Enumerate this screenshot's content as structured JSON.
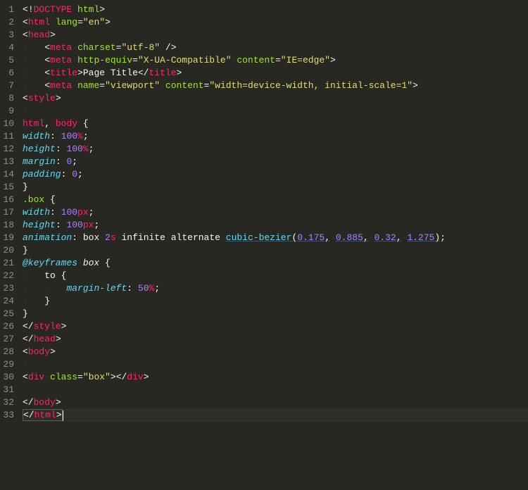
{
  "editor": {
    "line_count": 33,
    "lines": [
      {
        "n": 1,
        "raw": "<!DOCTYPE html>"
      },
      {
        "n": 2,
        "raw": "<html lang=\"en\">"
      },
      {
        "n": 3,
        "raw": "<head>"
      },
      {
        "n": 4,
        "raw": "    <meta charset=\"utf-8\" />"
      },
      {
        "n": 5,
        "raw": "    <meta http-equiv=\"X-UA-Compatible\" content=\"IE=edge\">"
      },
      {
        "n": 6,
        "raw": "    <title>Page Title</title>"
      },
      {
        "n": 7,
        "raw": "    <meta name=\"viewport\" content=\"width=device-width, initial-scale=1\">"
      },
      {
        "n": 8,
        "raw": "<style>"
      },
      {
        "n": 9,
        "raw": ""
      },
      {
        "n": 10,
        "raw": "html, body {"
      },
      {
        "n": 11,
        "raw": "width: 100%;"
      },
      {
        "n": 12,
        "raw": "height: 100%;"
      },
      {
        "n": 13,
        "raw": "margin: 0;"
      },
      {
        "n": 14,
        "raw": "padding: 0;"
      },
      {
        "n": 15,
        "raw": "}"
      },
      {
        "n": 16,
        "raw": ".box {"
      },
      {
        "n": 17,
        "raw": "width: 100px;"
      },
      {
        "n": 18,
        "raw": "height: 100px;"
      },
      {
        "n": 19,
        "raw": "animation: box 2s infinite alternate cubic-bezier(0.175, 0.885, 0.32, 1.275);"
      },
      {
        "n": 20,
        "raw": "}"
      },
      {
        "n": 21,
        "raw": "@keyframes box {"
      },
      {
        "n": 22,
        "raw": "    to {"
      },
      {
        "n": 23,
        "raw": "        margin-left: 50%;"
      },
      {
        "n": 24,
        "raw": "    }"
      },
      {
        "n": 25,
        "raw": "}"
      },
      {
        "n": 26,
        "raw": "</style>"
      },
      {
        "n": 27,
        "raw": "</head>"
      },
      {
        "n": 28,
        "raw": "<body>"
      },
      {
        "n": 29,
        "raw": ""
      },
      {
        "n": 30,
        "raw": "<div class=\"box\"></div>"
      },
      {
        "n": 31,
        "raw": ""
      },
      {
        "n": 32,
        "raw": "</body>"
      },
      {
        "n": 33,
        "raw": "</html>"
      }
    ],
    "title_text": "Page Title",
    "cubic_bezier_args": [
      0.175,
      0.885,
      0.32,
      1.275
    ],
    "cursor_line": 33
  },
  "colors": {
    "background": "#272822",
    "foreground": "#f8f8f2",
    "gutter_fg": "#8f908a",
    "pink": "#F92672",
    "green": "#A6E22E",
    "yellow": "#E6DB74",
    "blue": "#66D9EF",
    "purple": "#AE81FF"
  }
}
